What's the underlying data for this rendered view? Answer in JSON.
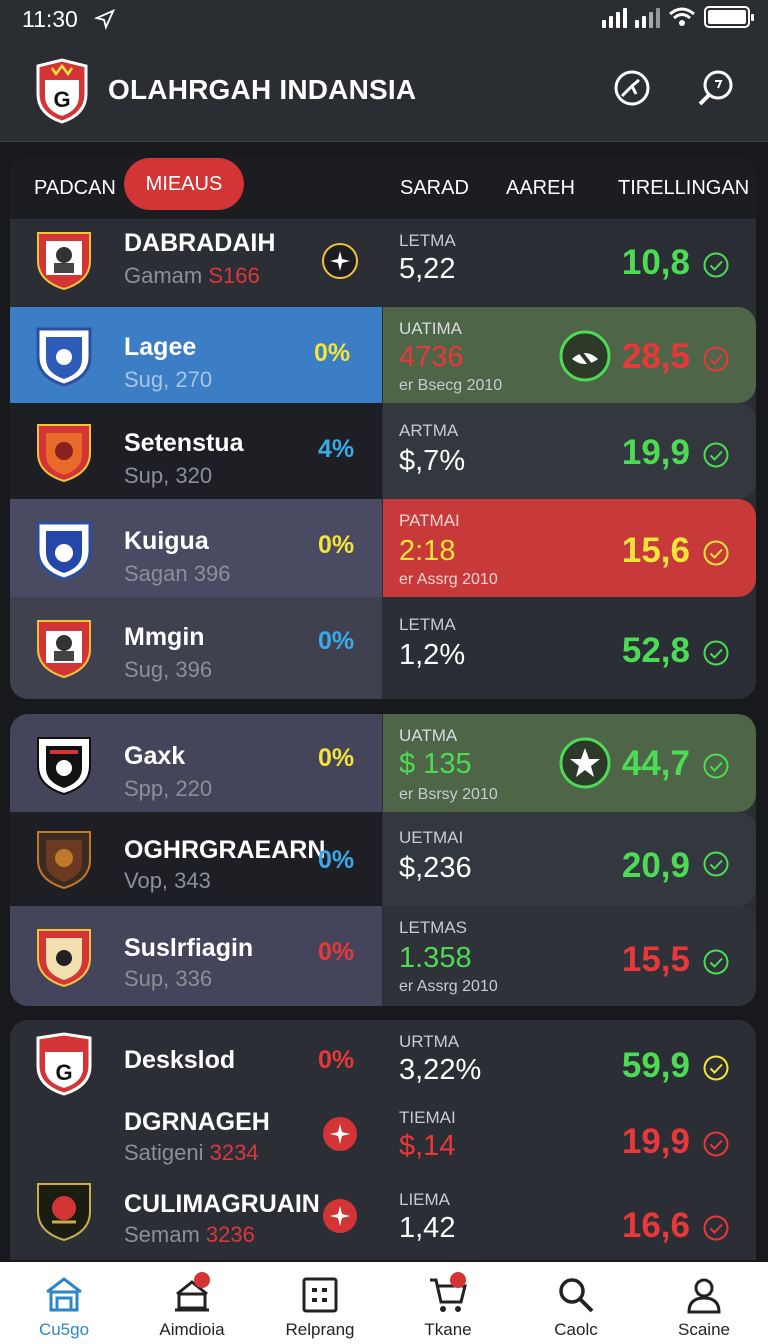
{
  "status": {
    "time": "11:30"
  },
  "app": {
    "title": "OLAHRGAH INDANSIA",
    "logo_letter": "G"
  },
  "tabs": {
    "t1": "PADCAN",
    "active": "MIEAUS",
    "t3": "SARAD",
    "t4": "AAREH",
    "t5": "TIRELLINGAN"
  },
  "colors": {
    "accent": "#d33536",
    "green": "#4ddb55",
    "yellow": "#f2e43a",
    "blue": "#3aa9e8",
    "red": "#e8383a"
  },
  "rows": [
    {
      "name": "DABRADAIH",
      "sub_prefix": "Gamam",
      "sub_suffix": "S166",
      "pct": "",
      "label": "LETMA",
      "value": "5,22",
      "note": "",
      "score": "10,8"
    },
    {
      "name": "Lagee",
      "sub": "Sug, 270",
      "pct": "0%",
      "label": "UATIMA",
      "value": "4736",
      "note": "er Bsecg 2010",
      "score": "28,5"
    },
    {
      "name": "Setenstua",
      "sub": "Sup, 320",
      "pct": "4%",
      "label": "ARTMA",
      "value": "$,7%",
      "note": "",
      "score": "19,9"
    },
    {
      "name": "Kuigua",
      "sub": "Sagan 396",
      "pct": "0%",
      "label": "PATMAI",
      "value": "2:18",
      "note": "er Assrg 2010",
      "score": "15,6"
    },
    {
      "name": "Mmgin",
      "sub": "Sug, 396",
      "pct": "0%",
      "label": "LETMA",
      "value": "1,2%",
      "note": "",
      "score": "52,8"
    },
    {
      "name": "Gaxk",
      "sub": "Spp, 220",
      "pct": "0%",
      "label": "UATMA",
      "value": "$ 135",
      "note": "er Bsrsy 2010",
      "score": "44,7"
    },
    {
      "name": "OGHRGRAEARN",
      "sub": "Vop, 343",
      "pct": "0%",
      "label": "UETMAI",
      "value": "$,236",
      "note": "",
      "score": "20,9"
    },
    {
      "name": "Suslrfiagin",
      "sub": "Sup, 336",
      "pct": "0%",
      "label": "LETMAS",
      "value": "1.358",
      "note": "er Assrg 2010",
      "score": "15,5"
    },
    {
      "name": "Deskslod",
      "sub": "",
      "pct": "0%",
      "label": "URTMA",
      "value": "3,22%",
      "note": "",
      "score": "59,9"
    },
    {
      "name": "DGRNAGEH",
      "sub_prefix": "Satigeni",
      "sub_suffix": "3234",
      "pct": "",
      "label": "TIEMAI",
      "value": "$,14",
      "note": "",
      "score": "19,9"
    },
    {
      "name": "CULIMAGRUAIN",
      "sub_prefix": "Semam",
      "sub_suffix": "3236",
      "pct": "",
      "label": "LIEMA",
      "value": "1,42",
      "note": "",
      "score": "16,6"
    }
  ],
  "nav": [
    {
      "label": "Cu5go",
      "icon": "home-icon"
    },
    {
      "label": "Aimdioia",
      "icon": "laptop-icon"
    },
    {
      "label": "Relprang",
      "icon": "grid-icon"
    },
    {
      "label": "Tkane",
      "icon": "cart-icon"
    },
    {
      "label": "Caolc",
      "icon": "search-icon"
    },
    {
      "label": "Scaine",
      "icon": "profile-icon"
    }
  ]
}
